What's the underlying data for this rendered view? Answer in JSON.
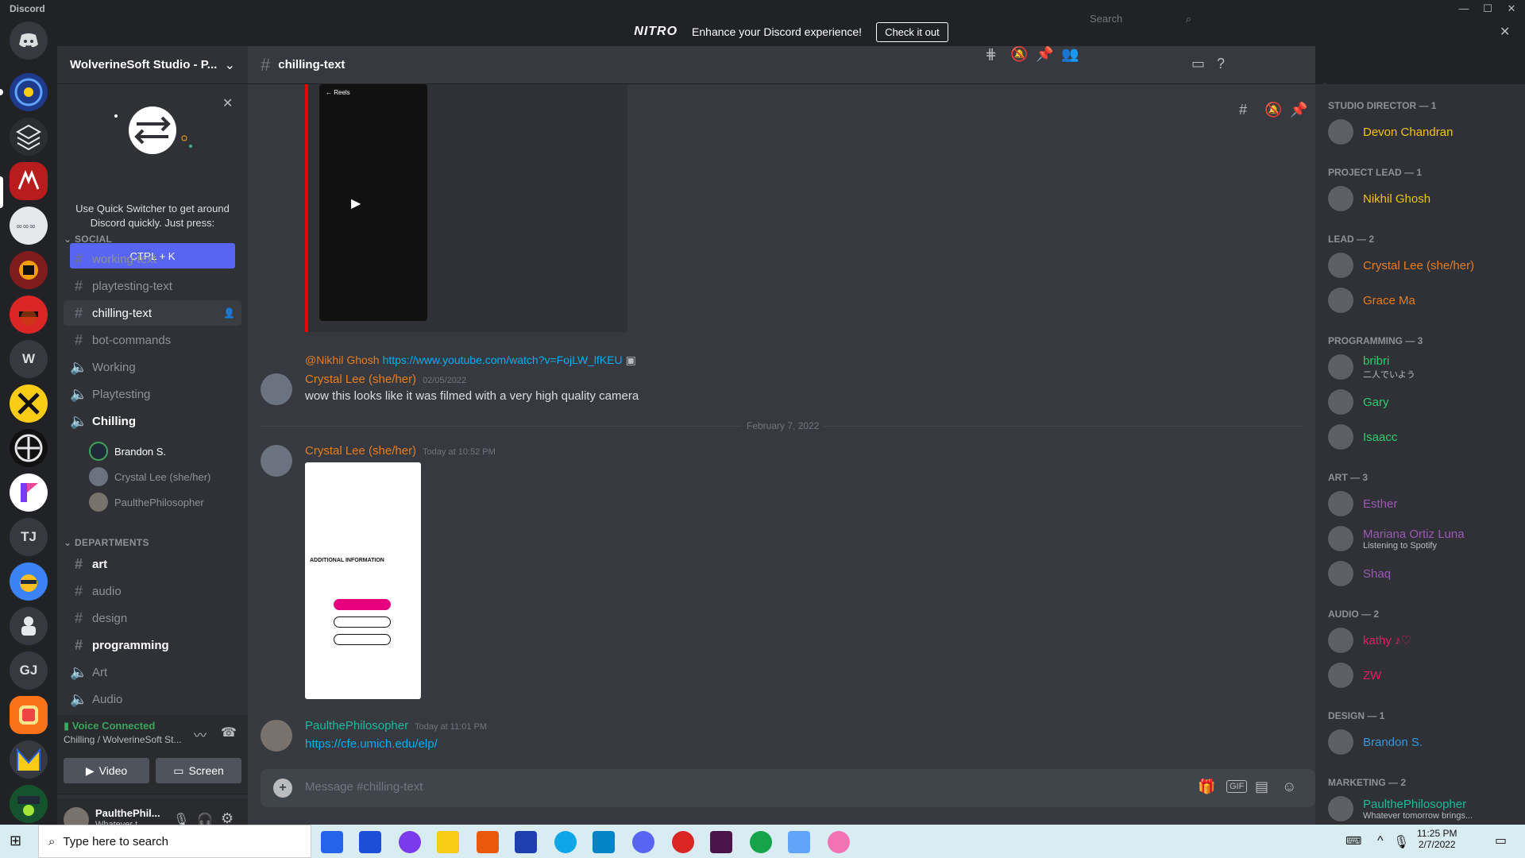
{
  "app": {
    "title": "Discord"
  },
  "nitro": {
    "logo": "NITRO",
    "message": "Enhance your Discord experience!",
    "cta": "Check it out"
  },
  "server": {
    "name": "WolverineSoft Studio - P..."
  },
  "quick_switcher": {
    "text": "Use Quick Switcher to get around Discord quickly. Just press:",
    "key": "CTRL + K"
  },
  "categories": {
    "social": "SOCIAL",
    "departments": "DEPARTMENTS"
  },
  "channels": [
    {
      "name": "working-text",
      "type": "text"
    },
    {
      "name": "playtesting-text",
      "type": "text"
    },
    {
      "name": "chilling-text",
      "type": "text"
    },
    {
      "name": "bot-commands",
      "type": "text"
    },
    {
      "name": "Working",
      "type": "voice"
    },
    {
      "name": "Playtesting",
      "type": "voice"
    },
    {
      "name": "Chilling",
      "type": "voice"
    }
  ],
  "voice_users": [
    "Brandon S.",
    "Crystal Lee (she/her)",
    "PaulthePhilosopher"
  ],
  "dept_channels": [
    {
      "name": "art",
      "type": "text"
    },
    {
      "name": "audio",
      "type": "text"
    },
    {
      "name": "design",
      "type": "text"
    },
    {
      "name": "programming",
      "type": "text"
    },
    {
      "name": "Art",
      "type": "voice"
    },
    {
      "name": "Audio",
      "type": "voice"
    }
  ],
  "voice": {
    "status": "Voice Connected",
    "location": "Chilling / WolverineSoft St...",
    "video": "Video",
    "screen": "Screen"
  },
  "user": {
    "name": "PaulthePhil...",
    "status": "Whatever t..."
  },
  "guild_initials": [
    "W",
    "TJ",
    "GJ"
  ],
  "chat": {
    "channel": "chilling-text",
    "search_placeholder": "Search",
    "reply": {
      "mention": "@Nikhil Ghosh",
      "link": "https://www.youtube.com/watch?v=FojLW_lfKEU"
    },
    "messages": [
      {
        "author": "Crystal Lee (she/her)",
        "time": "02/05/2022",
        "text": "wow this looks like it was filmed with a very high quality camera",
        "color": "#e67e22"
      },
      {
        "author": "Crystal Lee (she/her)",
        "time": "Today at 10:52 PM",
        "text": "",
        "color": "#e67e22"
      },
      {
        "author": "PaulthePhilosopher",
        "time": "Today at 11:01 PM",
        "text": "https://cfe.umich.edu/elp/",
        "color": "#1abc9c"
      }
    ],
    "divider": "February 7, 2022",
    "composer_placeholder": "Message #chilling-text",
    "gif_label": "GIF"
  },
  "members": {
    "groups": [
      {
        "role": "STUDIO DIRECTOR — 1",
        "members": [
          {
            "name": "Devon Chandran",
            "color": "#f1c40f",
            "sub": ""
          }
        ]
      },
      {
        "role": "PROJECT LEAD — 1",
        "members": [
          {
            "name": "Nikhil Ghosh",
            "color": "#f1c40f",
            "sub": ""
          }
        ]
      },
      {
        "role": "LEAD — 2",
        "members": [
          {
            "name": "Crystal Lee (she/her)",
            "color": "#e67e22",
            "sub": ""
          },
          {
            "name": "Grace Ma",
            "color": "#e67e22",
            "sub": ""
          }
        ]
      },
      {
        "role": "PROGRAMMING — 3",
        "members": [
          {
            "name": "bribri",
            "color": "#2ecc71",
            "sub": "二人でいよう"
          },
          {
            "name": "Gary",
            "color": "#2ecc71",
            "sub": ""
          },
          {
            "name": "Isaacc",
            "color": "#2ecc71",
            "sub": ""
          }
        ]
      },
      {
        "role": "ART — 3",
        "members": [
          {
            "name": "Esther",
            "color": "#9b59b6",
            "sub": ""
          },
          {
            "name": "Mariana Ortiz Luna",
            "color": "#9b59b6",
            "sub": "Listening to Spotify"
          },
          {
            "name": "Shaq",
            "color": "#9b59b6",
            "sub": ""
          }
        ]
      },
      {
        "role": "AUDIO — 2",
        "members": [
          {
            "name": "kathy ♪♡",
            "color": "#e91e63",
            "sub": ""
          },
          {
            "name": "ZW",
            "color": "#e91e63",
            "sub": ""
          }
        ]
      },
      {
        "role": "DESIGN — 1",
        "members": [
          {
            "name": "Brandon S.",
            "color": "#3498db",
            "sub": ""
          }
        ]
      },
      {
        "role": "MARKETING — 2",
        "members": [
          {
            "name": "PaulthePhilosopher",
            "color": "#1abc9c",
            "sub": "Whatever tomorrow brings..."
          }
        ]
      }
    ]
  },
  "taskbar": {
    "search": "Type here to search",
    "time": "11:25 PM",
    "date": "2/7/2022"
  }
}
